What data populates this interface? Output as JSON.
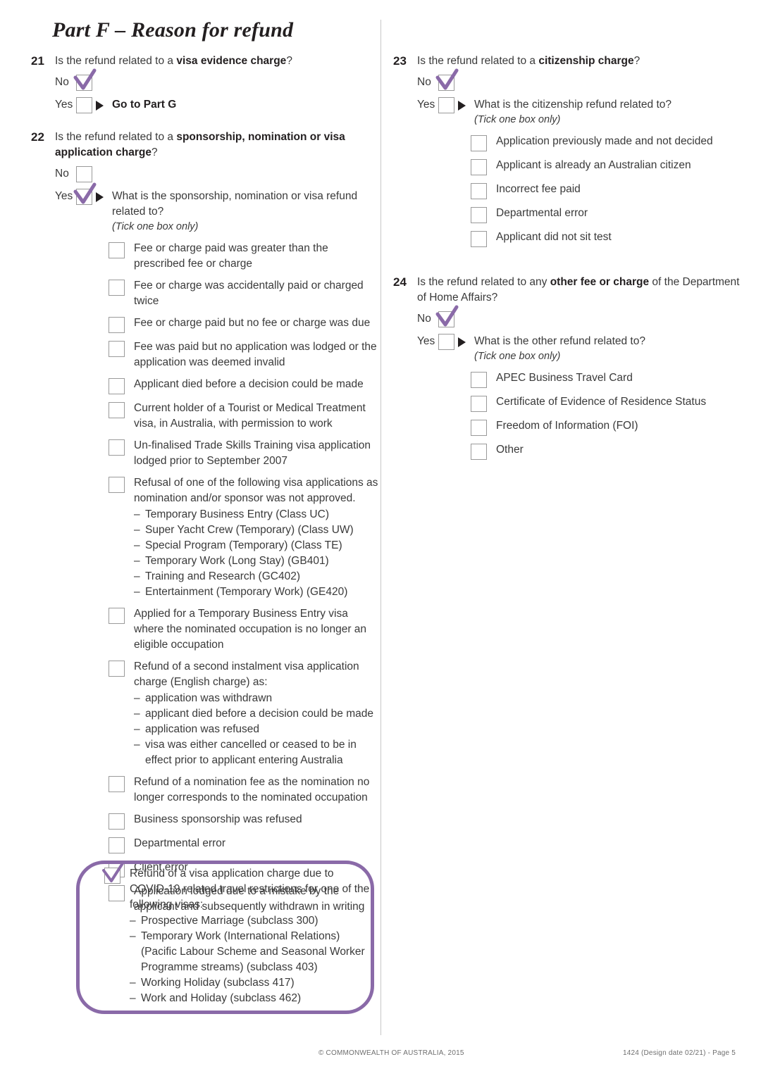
{
  "page": {
    "title": "Part F – Reason for refund",
    "tick_color": "#8a6aa8",
    "box_border_color": "#9a9a9a",
    "highlight_border_color": "#8a6aa8"
  },
  "footer": {
    "copyright": "© COMMONWEALTH OF AUSTRALIA, 2015",
    "form_ref": "1424 (Design date 02/21) - Page 5"
  },
  "labels": {
    "no": "No",
    "yes": "Yes",
    "tick_one": "(Tick one box only)",
    "dash": "–"
  },
  "q21": {
    "number": "21",
    "text_before": "Is the refund related to a ",
    "text_bold": "visa evidence charge",
    "text_after": "?",
    "yes_followup": "Go to Part G"
  },
  "q22": {
    "number": "22",
    "text_before": "Is the refund related to a ",
    "text_bold": "sponsorship, nomination or visa application charge",
    "text_after": "?",
    "yes_followup": "What is the sponsorship, nomination or visa refund related to?",
    "options": [
      {
        "label": "Fee or charge paid was greater than the prescribed fee or charge",
        "sub": []
      },
      {
        "label": "Fee or charge was accidentally paid or charged twice",
        "sub": []
      },
      {
        "label": "Fee or charge paid but no fee or charge was due",
        "sub": []
      },
      {
        "label": "Fee was paid but no application was lodged or the application was deemed invalid",
        "sub": []
      },
      {
        "label": "Applicant died before a decision could be made",
        "sub": []
      },
      {
        "label": "Current holder of a Tourist or Medical Treatment visa, in Australia, with permission to work",
        "sub": []
      },
      {
        "label": "Un-finalised Trade Skills Training visa application lodged prior to September 2007",
        "sub": []
      },
      {
        "label": "Refusal of one of the following visa applications as nomination and/or sponsor was not approved.",
        "sub": [
          "Temporary Business Entry (Class UC)",
          "Super Yacht Crew (Temporary) (Class UW)",
          "Special Program (Temporary) (Class TE)",
          "Temporary Work (Long Stay) (GB401)",
          "Training and Research (GC402)",
          "Entertainment (Temporary Work) (GE420)"
        ]
      },
      {
        "label": "Applied for a Temporary Business Entry visa where the nominated occupation is no longer an eligible occupation",
        "sub": []
      },
      {
        "label": "Refund of a second instalment visa application charge (English charge) as:",
        "sub": [
          "application was withdrawn",
          "applicant died before a decision could be made",
          "application was refused",
          "visa was either cancelled or ceased to be in effect prior to applicant entering Australia"
        ]
      },
      {
        "label": "Refund of a nomination fee as the nomination no longer corresponds to the nominated occupation",
        "sub": []
      },
      {
        "label": "Business sponsorship was refused",
        "sub": []
      },
      {
        "label": "Departmental error",
        "sub": []
      },
      {
        "label": "Client error",
        "sub": []
      },
      {
        "label": "Application lodged due to a mistake by the applicant and subsequently withdrawn in writing",
        "sub": []
      }
    ],
    "covid_option": {
      "label": "Refund of a visa application charge due to COVID-19 related travel restrictions for one of the following visas:",
      "checked": true,
      "sub": [
        "Prospective Marriage (subclass 300)",
        "Temporary Work (International Relations) (Pacific Labour Scheme and Seasonal Worker Programme streams) (subclass 403)",
        "Working Holiday (subclass 417)",
        "Work and Holiday (subclass 462)"
      ]
    }
  },
  "q23": {
    "number": "23",
    "text_before": "Is the refund related to a ",
    "text_bold": "citizenship charge",
    "text_after": "?",
    "yes_followup": "What is the citizenship refund related to?",
    "options": [
      "Application previously made and not decided",
      "Applicant is already an Australian citizen",
      "Incorrect fee paid",
      "Departmental error",
      "Applicant did not sit test"
    ]
  },
  "q24": {
    "number": "24",
    "text_before": "Is the refund related to any ",
    "text_bold": "other fee or charge",
    "text_after": " of the Department of Home Affairs?",
    "yes_followup": "What is the other refund related to?",
    "options": [
      "APEC Business Travel Card",
      "Certificate of Evidence of Residence Status",
      "Freedom of Information (FOI)",
      "Other"
    ]
  }
}
